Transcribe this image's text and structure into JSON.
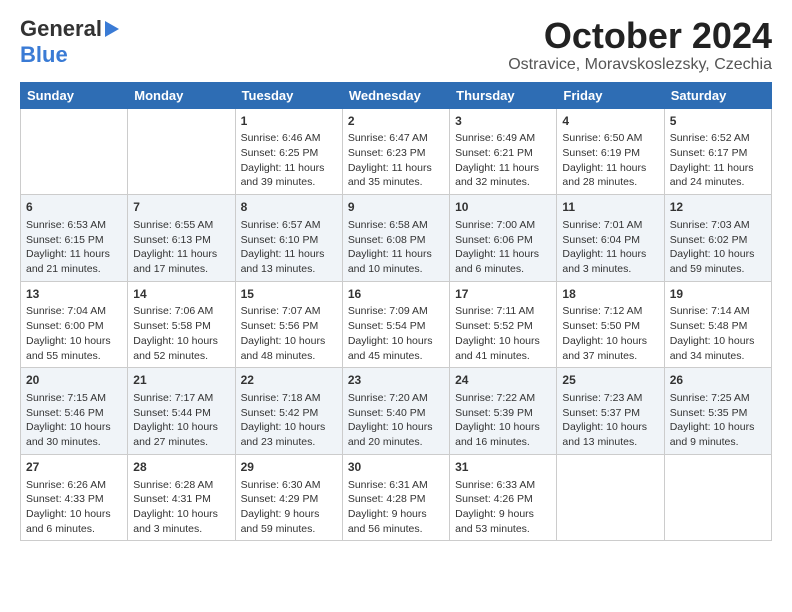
{
  "header": {
    "logo_general": "General",
    "logo_blue": "Blue",
    "title": "October 2024",
    "subtitle": "Ostravice, Moravskoslezsky, Czechia"
  },
  "calendar": {
    "weekdays": [
      "Sunday",
      "Monday",
      "Tuesday",
      "Wednesday",
      "Thursday",
      "Friday",
      "Saturday"
    ],
    "weeks": [
      [
        {
          "day": "",
          "info": ""
        },
        {
          "day": "",
          "info": ""
        },
        {
          "day": "1",
          "info": "Sunrise: 6:46 AM\nSunset: 6:25 PM\nDaylight: 11 hours and 39 minutes."
        },
        {
          "day": "2",
          "info": "Sunrise: 6:47 AM\nSunset: 6:23 PM\nDaylight: 11 hours and 35 minutes."
        },
        {
          "day": "3",
          "info": "Sunrise: 6:49 AM\nSunset: 6:21 PM\nDaylight: 11 hours and 32 minutes."
        },
        {
          "day": "4",
          "info": "Sunrise: 6:50 AM\nSunset: 6:19 PM\nDaylight: 11 hours and 28 minutes."
        },
        {
          "day": "5",
          "info": "Sunrise: 6:52 AM\nSunset: 6:17 PM\nDaylight: 11 hours and 24 minutes."
        }
      ],
      [
        {
          "day": "6",
          "info": "Sunrise: 6:53 AM\nSunset: 6:15 PM\nDaylight: 11 hours and 21 minutes."
        },
        {
          "day": "7",
          "info": "Sunrise: 6:55 AM\nSunset: 6:13 PM\nDaylight: 11 hours and 17 minutes."
        },
        {
          "day": "8",
          "info": "Sunrise: 6:57 AM\nSunset: 6:10 PM\nDaylight: 11 hours and 13 minutes."
        },
        {
          "day": "9",
          "info": "Sunrise: 6:58 AM\nSunset: 6:08 PM\nDaylight: 11 hours and 10 minutes."
        },
        {
          "day": "10",
          "info": "Sunrise: 7:00 AM\nSunset: 6:06 PM\nDaylight: 11 hours and 6 minutes."
        },
        {
          "day": "11",
          "info": "Sunrise: 7:01 AM\nSunset: 6:04 PM\nDaylight: 11 hours and 3 minutes."
        },
        {
          "day": "12",
          "info": "Sunrise: 7:03 AM\nSunset: 6:02 PM\nDaylight: 10 hours and 59 minutes."
        }
      ],
      [
        {
          "day": "13",
          "info": "Sunrise: 7:04 AM\nSunset: 6:00 PM\nDaylight: 10 hours and 55 minutes."
        },
        {
          "day": "14",
          "info": "Sunrise: 7:06 AM\nSunset: 5:58 PM\nDaylight: 10 hours and 52 minutes."
        },
        {
          "day": "15",
          "info": "Sunrise: 7:07 AM\nSunset: 5:56 PM\nDaylight: 10 hours and 48 minutes."
        },
        {
          "day": "16",
          "info": "Sunrise: 7:09 AM\nSunset: 5:54 PM\nDaylight: 10 hours and 45 minutes."
        },
        {
          "day": "17",
          "info": "Sunrise: 7:11 AM\nSunset: 5:52 PM\nDaylight: 10 hours and 41 minutes."
        },
        {
          "day": "18",
          "info": "Sunrise: 7:12 AM\nSunset: 5:50 PM\nDaylight: 10 hours and 37 minutes."
        },
        {
          "day": "19",
          "info": "Sunrise: 7:14 AM\nSunset: 5:48 PM\nDaylight: 10 hours and 34 minutes."
        }
      ],
      [
        {
          "day": "20",
          "info": "Sunrise: 7:15 AM\nSunset: 5:46 PM\nDaylight: 10 hours and 30 minutes."
        },
        {
          "day": "21",
          "info": "Sunrise: 7:17 AM\nSunset: 5:44 PM\nDaylight: 10 hours and 27 minutes."
        },
        {
          "day": "22",
          "info": "Sunrise: 7:18 AM\nSunset: 5:42 PM\nDaylight: 10 hours and 23 minutes."
        },
        {
          "day": "23",
          "info": "Sunrise: 7:20 AM\nSunset: 5:40 PM\nDaylight: 10 hours and 20 minutes."
        },
        {
          "day": "24",
          "info": "Sunrise: 7:22 AM\nSunset: 5:39 PM\nDaylight: 10 hours and 16 minutes."
        },
        {
          "day": "25",
          "info": "Sunrise: 7:23 AM\nSunset: 5:37 PM\nDaylight: 10 hours and 13 minutes."
        },
        {
          "day": "26",
          "info": "Sunrise: 7:25 AM\nSunset: 5:35 PM\nDaylight: 10 hours and 9 minutes."
        }
      ],
      [
        {
          "day": "27",
          "info": "Sunrise: 6:26 AM\nSunset: 4:33 PM\nDaylight: 10 hours and 6 minutes."
        },
        {
          "day": "28",
          "info": "Sunrise: 6:28 AM\nSunset: 4:31 PM\nDaylight: 10 hours and 3 minutes."
        },
        {
          "day": "29",
          "info": "Sunrise: 6:30 AM\nSunset: 4:29 PM\nDaylight: 9 hours and 59 minutes."
        },
        {
          "day": "30",
          "info": "Sunrise: 6:31 AM\nSunset: 4:28 PM\nDaylight: 9 hours and 56 minutes."
        },
        {
          "day": "31",
          "info": "Sunrise: 6:33 AM\nSunset: 4:26 PM\nDaylight: 9 hours and 53 minutes."
        },
        {
          "day": "",
          "info": ""
        },
        {
          "day": "",
          "info": ""
        }
      ]
    ]
  }
}
